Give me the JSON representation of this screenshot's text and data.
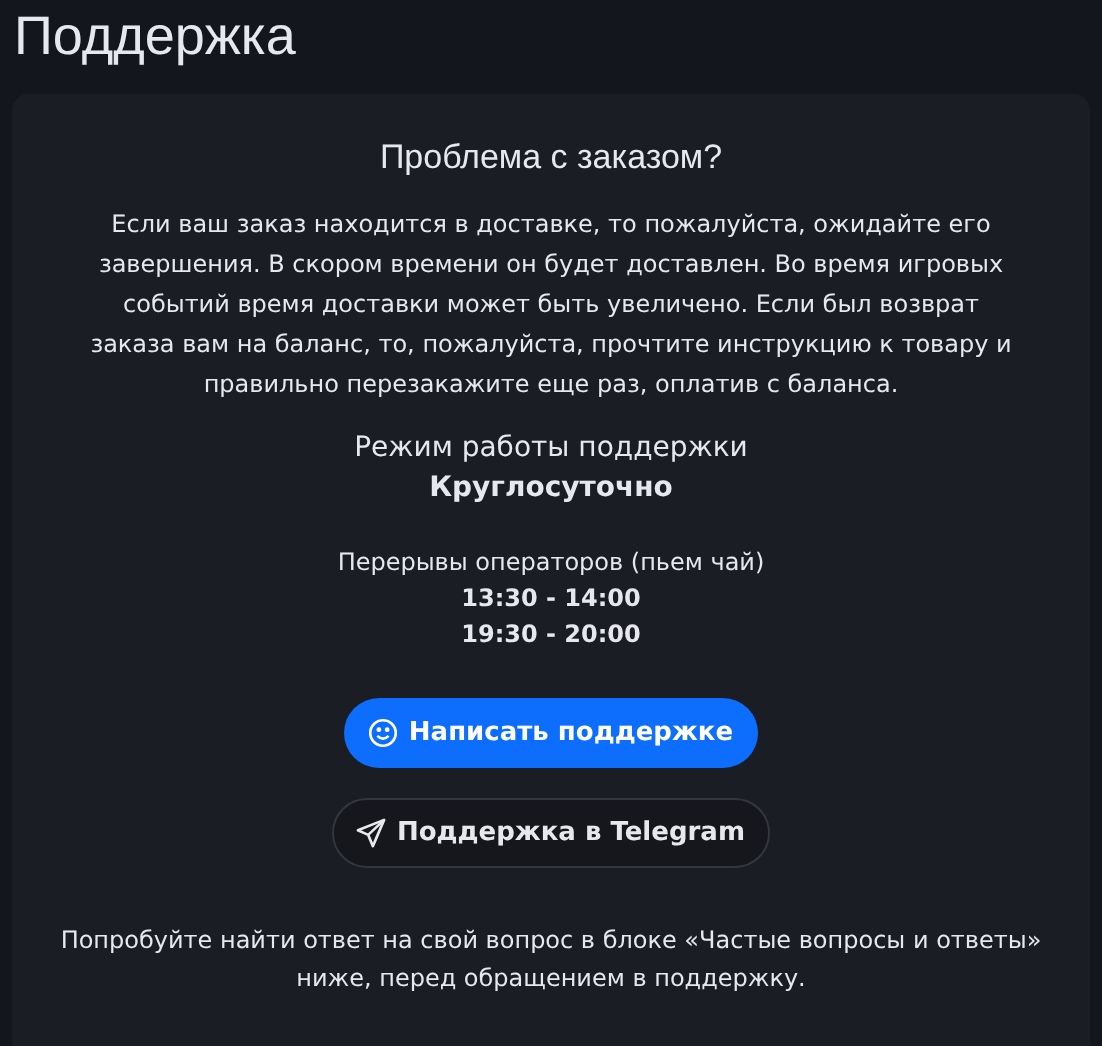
{
  "page_title": "Поддержка",
  "card": {
    "heading": "Проблема с заказом?",
    "description": "Если ваш заказ находится в доставке, то пожалуйста, ожидайте его завершения. В скором времени он будет доставлен. Во время игровых событий время доставки может быть увеличено. Если был возврат заказа вам на баланс, то, пожалуйста, прочтите инструкцию к товару и правильно перезакажите еще раз, оплатив с баланса.",
    "schedule_label": "Режим работы поддержки",
    "schedule_value": "Круглосуточно",
    "breaks_label": "Перерывы операторов (пьем чай)",
    "breaks": [
      "13:30 - 14:00",
      "19:30 - 20:00"
    ],
    "buttons": [
      {
        "kind": "primary",
        "label": "Написать поддержке"
      },
      {
        "kind": "telegram",
        "label": "Поддержка в Telegram"
      }
    ],
    "note": "Попробуйте найти ответ на свой вопрос в блоке «Частые вопросы и ответы» ниже, перед обращением в поддержку."
  }
}
